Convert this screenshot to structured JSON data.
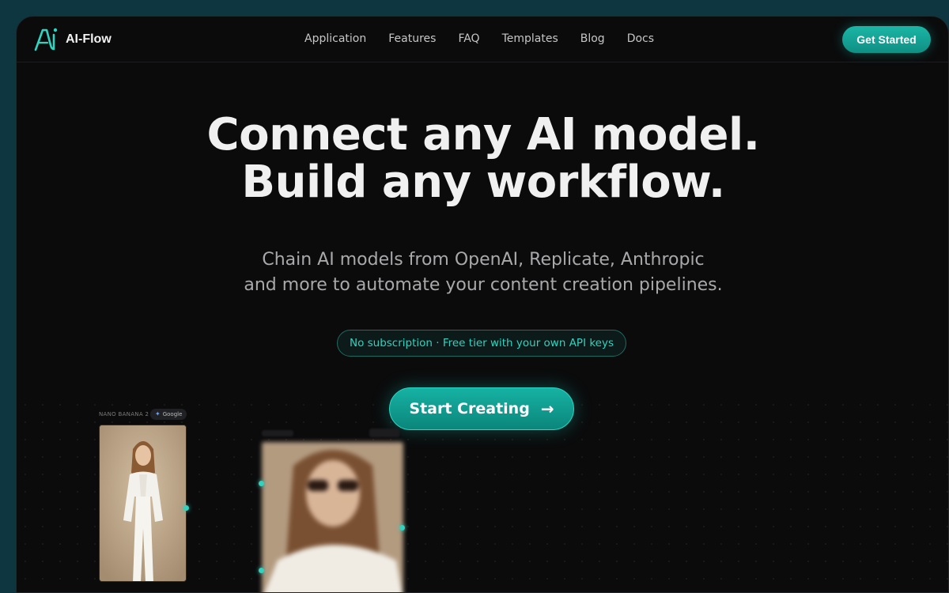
{
  "app": {
    "name": "AI-Flow"
  },
  "nav": {
    "items": [
      "Application",
      "Features",
      "FAQ",
      "Templates",
      "Blog",
      "Docs"
    ],
    "cta_label": "Get Started"
  },
  "hero": {
    "headline_line1": "Connect any AI model.",
    "headline_line2": "Build any workflow.",
    "subtitle_line1": "Chain AI models from OpenAI, Replicate, Anthropic",
    "subtitle_line2": "and more to automate your content creation pipelines.",
    "pill_text": "No subscription · Free tier with your own API keys",
    "cta_label": "Start Creating"
  },
  "nodes": [
    {
      "label": "NANO BANANA 2",
      "provider": "Google"
    }
  ],
  "colors": {
    "accent": "#16b2a3",
    "background": "#0b0b0c",
    "outer": "#0e3640"
  }
}
